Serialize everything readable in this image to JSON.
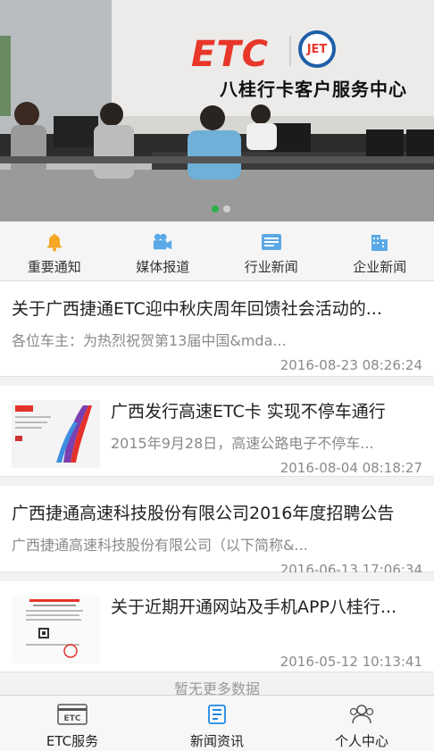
{
  "banner": {
    "brand_logo": "ETC",
    "brand_badge": "JET",
    "brand_subtitle": "八桂行卡客户服务中心",
    "slide_index": 1,
    "slide_count": 2
  },
  "categories": [
    {
      "label": "重要通知",
      "icon": "bell-icon"
    },
    {
      "label": "媒体报道",
      "icon": "video-camera-icon"
    },
    {
      "label": "行业新闻",
      "icon": "newspaper-icon"
    },
    {
      "label": "企业新闻",
      "icon": "building-icon"
    }
  ],
  "news": [
    {
      "title": "关于广西捷通ETC迎中秋庆周年回馈社会活动的...",
      "desc": "各位车主：为热烈祝贺第13届中国&mda...",
      "date": "2016-08-23 08:26:24"
    },
    {
      "title": "广西发行高速ETC卡 实现不停车通行",
      "desc": "2015年9月28日，高速公路电子不停车...",
      "date": "2016-08-04 08:18:27"
    },
    {
      "title": "广西捷通高速科技股份有限公司2016年度招聘公告",
      "desc": "广西捷通高速科技股份有限公司（以下简称&...",
      "date": "2016-06-13 17:06:34"
    },
    {
      "title": "关于近期开通网站及手机APP八桂行...",
      "desc": "",
      "date": "2016-05-12 10:13:41"
    }
  ],
  "more_text": "暂无更多数据",
  "tabs": [
    {
      "label": "ETC服务",
      "icon": "etc-card-icon",
      "active": false
    },
    {
      "label": "新闻资讯",
      "icon": "news-icon",
      "active": true
    },
    {
      "label": "个人中心",
      "icon": "people-icon",
      "active": false
    }
  ],
  "colors": {
    "accent": "#f5a623",
    "active_tab": "#1e88e5",
    "dot_active": "#2db34a"
  }
}
